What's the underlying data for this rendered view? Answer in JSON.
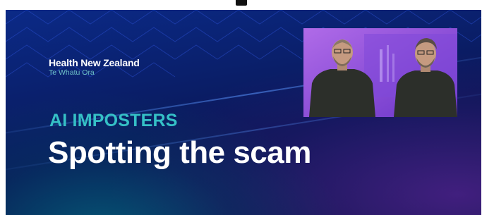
{
  "brand": {
    "name": "Health New Zealand",
    "subtitle": "Te Whatu Ora"
  },
  "slide": {
    "kicker": "AI IMPOSTERS",
    "headline": "Spotting the scam"
  },
  "colors": {
    "background_dark_blue": "#0a1654",
    "background_blue": "#0b2a87",
    "accent_teal": "#35c0c6",
    "subtitle_teal": "#6fc3c8",
    "video_purple": "#7b3fcf",
    "text_white": "#ffffff"
  },
  "icons": {
    "top_glyph": "partial-character-glyph"
  }
}
